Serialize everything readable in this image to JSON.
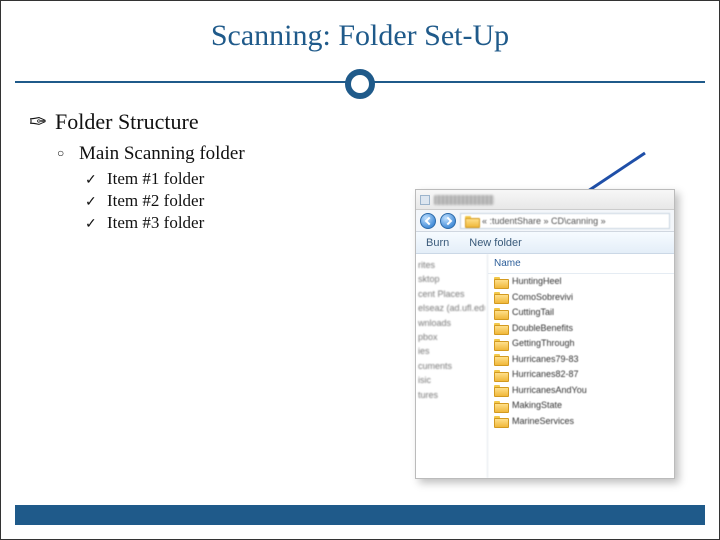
{
  "title": "Scanning: Folder Set-Up",
  "outline": {
    "lvl1": "Folder Structure",
    "lvl2": "Main Scanning folder",
    "lvl3": [
      "Item #1 folder",
      "Item #2 folder",
      "Item #3 folder"
    ]
  },
  "explorer": {
    "breadcrumb": "« :tudentShare » CD\\canning »",
    "toolbar": {
      "burn": "Burn",
      "newFolder": "New folder"
    },
    "columnHeader": "Name",
    "sidebar": [
      "rites",
      "sktop",
      "cent Places",
      "elseaz (ad.ufl.edu",
      "wnloads",
      "pbox",
      "",
      "ies",
      "cuments",
      "isic",
      "tures"
    ],
    "folders": [
      "HuntingHeel",
      "ComoSobrevivi",
      "CuttingTail",
      "DoubleBenefits",
      "GettingThrough",
      "Hurricanes79-83",
      "Hurricanes82-87",
      "HurricanesAndYou",
      "MakingState",
      "MarineServices"
    ]
  }
}
